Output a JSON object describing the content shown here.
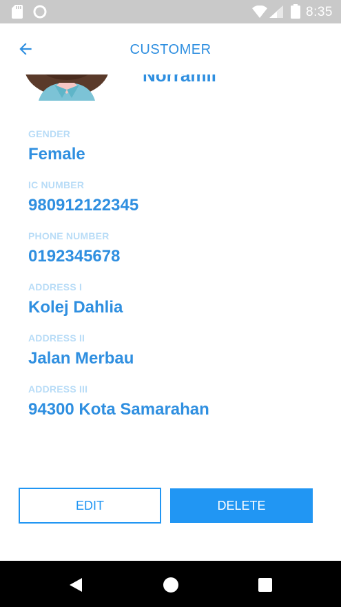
{
  "status_bar": {
    "time": "8:35",
    "icons": [
      "sd-card-icon",
      "sync-icon",
      "wifi-icon",
      "signal-icon",
      "battery-icon"
    ]
  },
  "app_bar": {
    "title": "CUSTOMER",
    "back_icon": "arrow-back-icon"
  },
  "profile": {
    "name": "Norramli",
    "avatar_icon": "female-avatar-icon"
  },
  "fields": [
    {
      "label": "GENDER",
      "value": "Female"
    },
    {
      "label": "IC NUMBER",
      "value": "980912122345"
    },
    {
      "label": "PHONE NUMBER",
      "value": "0192345678"
    },
    {
      "label": "ADDRESS I",
      "value": "Kolej Dahlia"
    },
    {
      "label": "ADDRESS II",
      "value": "Jalan Merbau"
    },
    {
      "label": "ADDRESS III",
      "value": "94300 Kota Samarahan"
    }
  ],
  "actions": {
    "edit_label": "EDIT",
    "delete_label": "DELETE"
  },
  "colors": {
    "accent": "#2196f3",
    "text_primary": "#2f8fe0",
    "label": "#b8dcf7",
    "status_bar": "#c9c9c9",
    "nav_bar": "#000000"
  },
  "nav_bar": {
    "icons": [
      "nav-back-icon",
      "nav-home-icon",
      "nav-recents-icon"
    ]
  }
}
